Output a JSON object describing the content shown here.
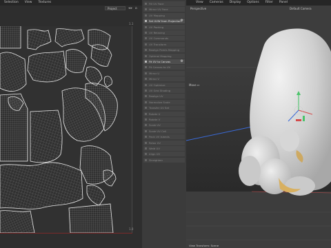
{
  "uv_editor": {
    "menu": [
      "Selection",
      "View",
      "Textures"
    ],
    "projection_select": "Project",
    "range_top_label": "1.1",
    "range_bottom_label": "1.0"
  },
  "commands": {
    "items": [
      {
        "label": "Fill UV Face",
        "active": false
      },
      {
        "label": "Mirror UV Face",
        "active": false
      },
      {
        "label": "UV Mapping",
        "active": false
      },
      {
        "label": "Set UVW from Projection",
        "active": true
      },
      {
        "label": "UV Packing",
        "active": false
      },
      {
        "label": "UV Relaxing",
        "active": false
      },
      {
        "label": "UV Commands",
        "active": false
      },
      {
        "label": "UV Transform",
        "active": false
      },
      {
        "label": "Realign Points Mapping",
        "active": false
      },
      {
        "label": "Optimal Mapping",
        "active": false
      },
      {
        "label": "Fit UV to Canvas",
        "active": true
      },
      {
        "label": "Fit Canvas to UV",
        "active": false
      },
      {
        "label": "Mirror U",
        "active": false
      },
      {
        "label": "Mirror V",
        "active": false
      },
      {
        "label": "UV Optimize",
        "active": false
      },
      {
        "label": "UV Grid Shading",
        "active": false
      },
      {
        "label": "Realign UV",
        "active": false
      },
      {
        "label": "Normalize Scale",
        "active": false
      },
      {
        "label": "Transfer UV Set",
        "active": false
      },
      {
        "label": "Rotate U",
        "active": false
      },
      {
        "label": "Rotate V",
        "active": false
      },
      {
        "label": "Scale UV",
        "active": false
      },
      {
        "label": "Scale UV Cell",
        "active": false
      },
      {
        "label": "Pack UV Islands",
        "active": false
      },
      {
        "label": "Relax UV",
        "active": false
      },
      {
        "label": "Weld UV",
        "active": false
      },
      {
        "label": "Align UV",
        "active": false
      },
      {
        "label": "Straighten",
        "active": false
      }
    ]
  },
  "viewport": {
    "menu": [
      "View",
      "Cameras",
      "Display",
      "Options",
      "Filter",
      "Panel"
    ],
    "view_name": "Perspective",
    "camera_name": "Default Camera",
    "move_label": "Move",
    "footer": "View Transform: Scene"
  },
  "colors": {
    "mesh": "#dcdcdc",
    "wire": "#e6e6e6",
    "axis_x": "#d44a4a",
    "axis_y": "#4ac46a",
    "axis_z": "#3a6ad8",
    "bottom_edge": "#7a2a2a"
  }
}
